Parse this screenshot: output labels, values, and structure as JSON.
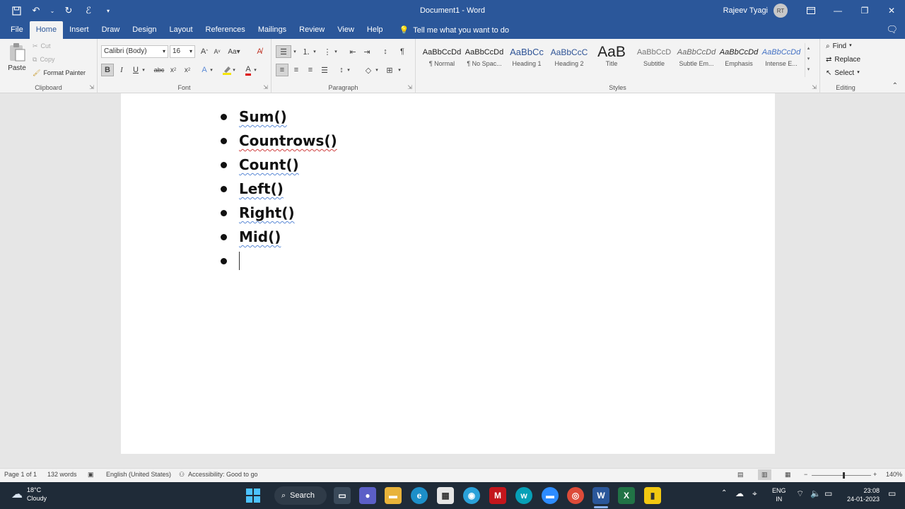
{
  "titlebar": {
    "doc_title": "Document1  -  Word",
    "user_name": "Rajeev Tyagi",
    "avatar_initials": "RT"
  },
  "tabs": [
    "File",
    "Home",
    "Insert",
    "Draw",
    "Design",
    "Layout",
    "References",
    "Mailings",
    "Review",
    "View",
    "Help"
  ],
  "tellme": "Tell me what you want to do",
  "clipboard": {
    "paste": "Paste",
    "cut": "Cut",
    "copy": "Copy",
    "format_painter": "Format Painter",
    "label": "Clipboard"
  },
  "font": {
    "name": "Calibri (Body)",
    "size": "16",
    "label": "Font"
  },
  "paragraph": {
    "label": "Paragraph"
  },
  "styles": {
    "label": "Styles",
    "items": [
      {
        "sample": "AaBbCcDd",
        "name": "¶ Normal"
      },
      {
        "sample": "AaBbCcDd",
        "name": "¶ No Spac..."
      },
      {
        "sample": "AaBbCc",
        "name": "Heading 1"
      },
      {
        "sample": "AaBbCcC",
        "name": "Heading 2"
      },
      {
        "sample": "AaB",
        "name": "Title"
      },
      {
        "sample": "AaBbCcD",
        "name": "Subtitle"
      },
      {
        "sample": "AaBbCcDd",
        "name": "Subtle Em..."
      },
      {
        "sample": "AaBbCcDd",
        "name": "Emphasis"
      },
      {
        "sample": "AaBbCcDd",
        "name": "Intense E..."
      }
    ]
  },
  "editing": {
    "find": "Find",
    "replace": "Replace",
    "select": "Select",
    "label": "Editing"
  },
  "document": {
    "bullets": [
      "Sum()",
      "Countrows()",
      "Count()",
      "Left()",
      "Right()",
      "Mid()",
      ""
    ]
  },
  "statusbar": {
    "page": "Page 1 of 1",
    "words": "132 words",
    "language": "English (United States)",
    "accessibility": "Accessibility: Good to go",
    "zoom": "140%"
  },
  "taskbar": {
    "weather_temp": "18°C",
    "weather_desc": "Cloudy",
    "search": "Search",
    "lang_top": "ENG",
    "lang_bottom": "IN",
    "time": "23:08",
    "date": "24-01-2023"
  },
  "colors": {
    "word_blue": "#2b579a",
    "ribbon_bg": "#f3f3f3",
    "taskbar_bg": "#1f2b38"
  }
}
